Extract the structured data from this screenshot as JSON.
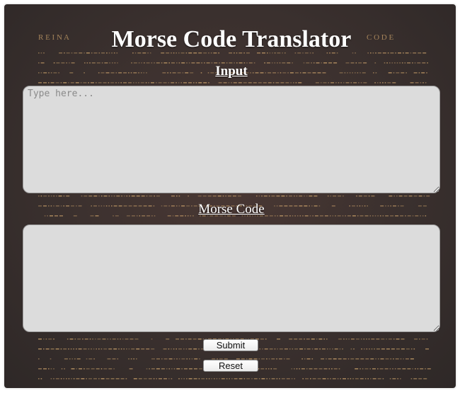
{
  "app": {
    "title": "Morse Code Translator",
    "background_words": [
      "R E I N A",
      "C O D E"
    ],
    "colors": {
      "background": "#3a302e",
      "text": "#ffffff",
      "field": "#dcdcdc",
      "morse_accent": "#c9a06a"
    }
  },
  "input": {
    "label": "Input",
    "placeholder": "Type here...",
    "value": ""
  },
  "output": {
    "label": "Morse Code",
    "value": ""
  },
  "buttons": {
    "submit_label": "Submit",
    "reset_label": "Reset"
  }
}
